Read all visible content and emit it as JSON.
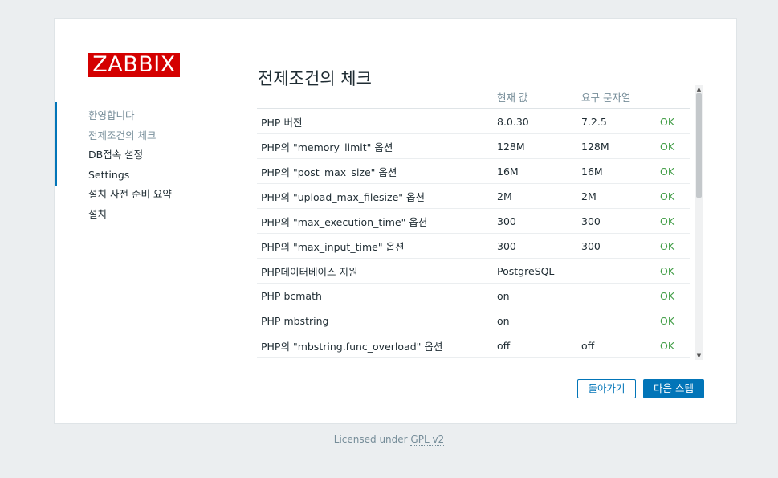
{
  "brand": {
    "logo_text": "ZABBIX",
    "logo_color": "#d40000"
  },
  "nav": {
    "items": [
      {
        "label": "환영합니다",
        "state": "done"
      },
      {
        "label": "전제조건의 체크",
        "state": "current"
      },
      {
        "label": "DB접속 설정",
        "state": "pending"
      },
      {
        "label": "Settings",
        "state": "pending"
      },
      {
        "label": "설치 사전 준비 요약",
        "state": "pending"
      },
      {
        "label": "설치",
        "state": "pending"
      }
    ]
  },
  "main": {
    "title": "전제조건의 체크",
    "table": {
      "headers": [
        "",
        "현재 값",
        "요구 문자열",
        ""
      ],
      "rows": [
        {
          "name": "PHP 버전",
          "current": "8.0.30",
          "required": "7.2.5",
          "status": "OK"
        },
        {
          "name": "PHP의 \"memory_limit\" 옵션",
          "current": "128M",
          "required": "128M",
          "status": "OK"
        },
        {
          "name": "PHP의 \"post_max_size\" 옵션",
          "current": "16M",
          "required": "16M",
          "status": "OK"
        },
        {
          "name": "PHP의 \"upload_max_filesize\" 옵션",
          "current": "2M",
          "required": "2M",
          "status": "OK"
        },
        {
          "name": "PHP의 \"max_execution_time\" 옵션",
          "current": "300",
          "required": "300",
          "status": "OK"
        },
        {
          "name": "PHP의 \"max_input_time\" 옵션",
          "current": "300",
          "required": "300",
          "status": "OK"
        },
        {
          "name": "PHP데이터베이스 지원",
          "current": "PostgreSQL",
          "required": "",
          "status": "OK"
        },
        {
          "name": "PHP bcmath",
          "current": "on",
          "required": "",
          "status": "OK"
        },
        {
          "name": "PHP mbstring",
          "current": "on",
          "required": "",
          "status": "OK"
        },
        {
          "name": "PHP의 \"mbstring.func_overload\" 옵션",
          "current": "off",
          "required": "off",
          "status": "OK"
        }
      ]
    },
    "buttons": {
      "back": "돌아가기",
      "next": "다음 스텝"
    }
  },
  "footer": {
    "prefix": "Licensed under ",
    "link": "GPL v2"
  },
  "colors": {
    "accent": "#0275b8",
    "ok": "#429e47",
    "muted": "#768d99"
  }
}
